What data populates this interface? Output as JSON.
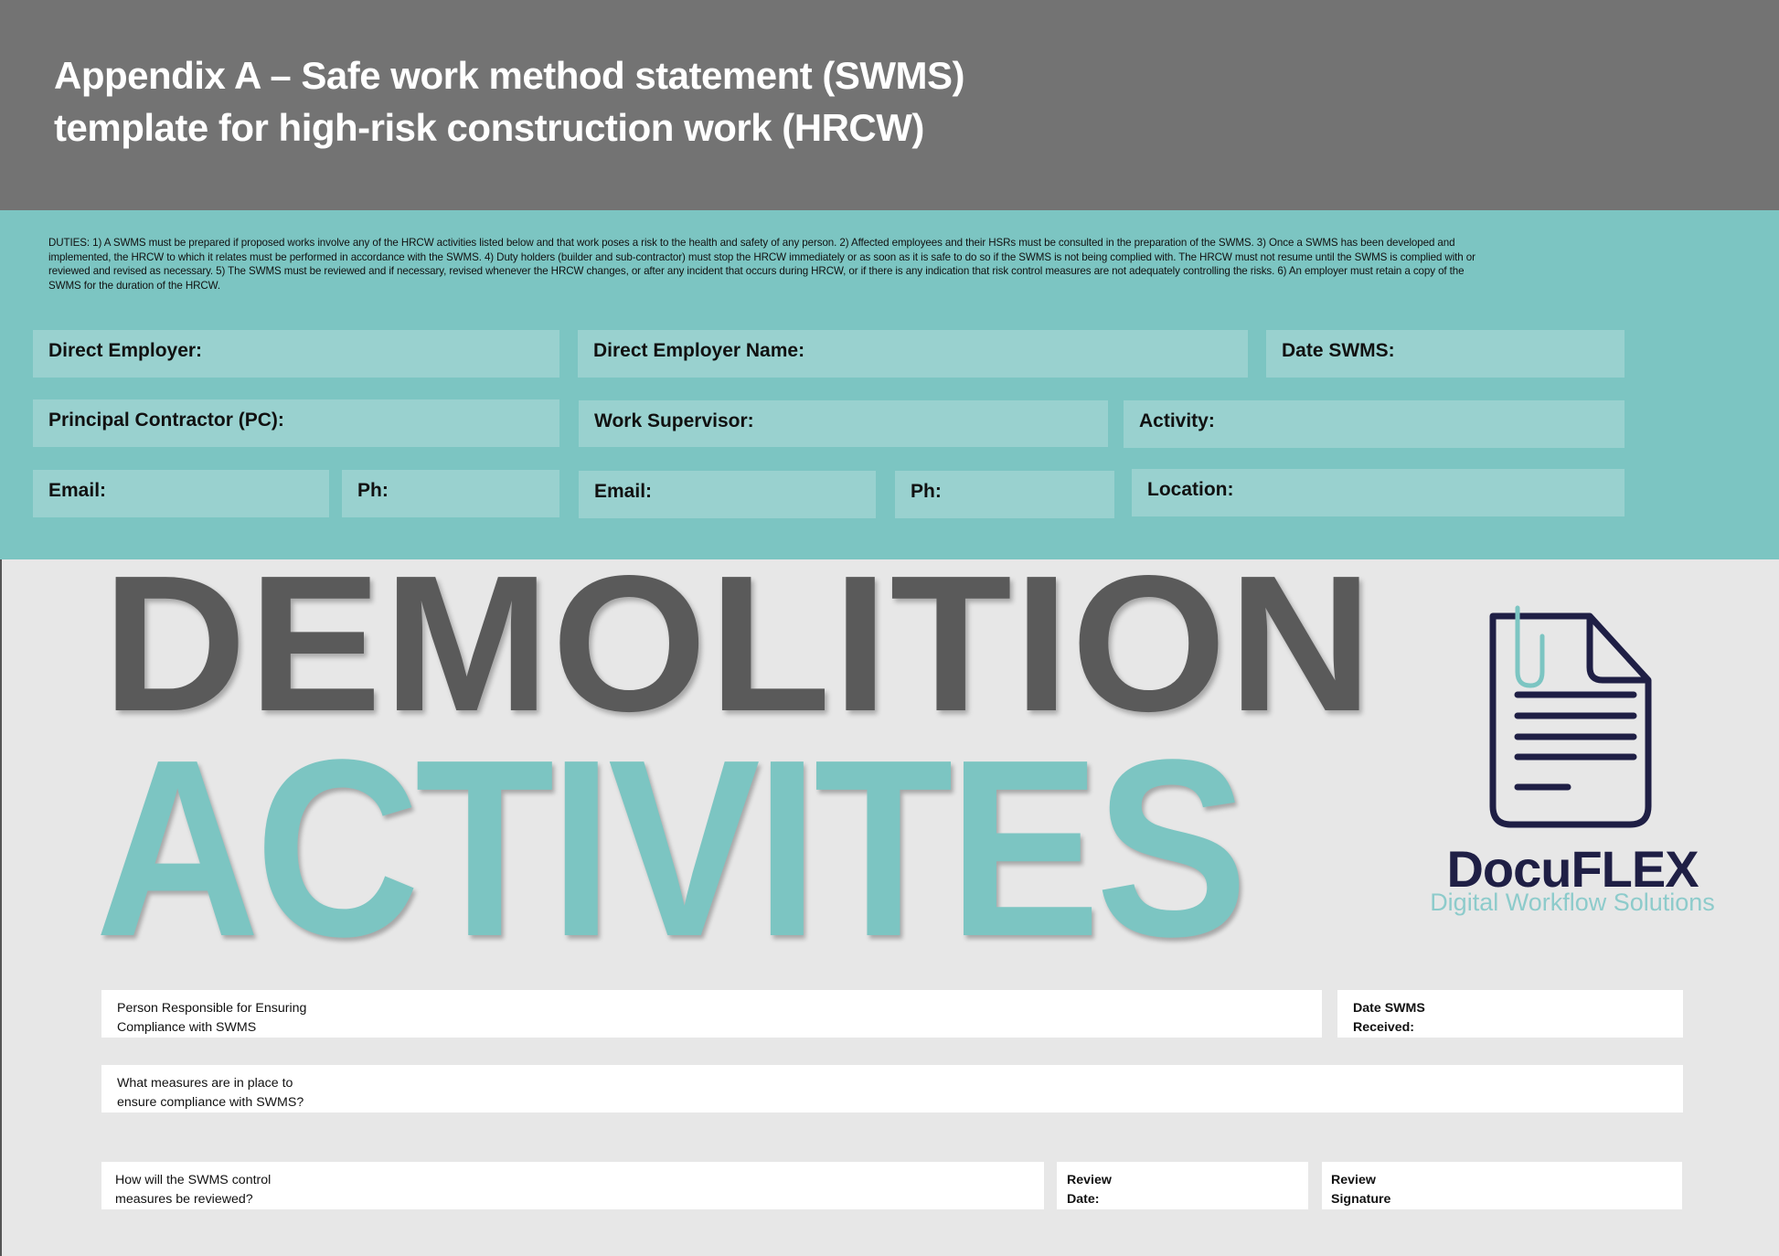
{
  "header": {
    "title_line1": "Appendix A – Safe work method statement (SWMS)",
    "title_line2": "template for high-risk construction work (HRCW)"
  },
  "duties": {
    "text": "DUTIES: 1) A SWMS must be prepared if proposed works involve any of the HRCW activities listed below and that work poses a risk to the health and safety of any person. 2) Affected employees and their HSRs must be consulted in the preparation of the SWMS. 3) Once a SWMS has been developed and implemented, the HRCW to which it relates must be performed in accordance with the SWMS. 4) Duty holders (builder and sub-contractor) must stop the HRCW immediately or as soon as it is safe to do so if the SWMS is not being complied with. The HRCW must not resume until the SWMS is complied with or reviewed and revised as necessary. 5) The SWMS must be reviewed and if necessary, revised whenever the HRCW changes, or after any incident that occurs during HRCW, or if there is any indication that risk control measures are not adequately controlling the risks. 6) An employer must retain a copy of the SWMS for the duration of the HRCW."
  },
  "fields": {
    "direct_employer": "Direct Employer:",
    "direct_employer_name": "Direct Employer Name:",
    "date_swms": "Date SWMS:",
    "principal_contractor": "Principal Contractor (PC):",
    "work_supervisor": "Work Supervisor:",
    "activity": "Activity:",
    "pc_email": "Email:",
    "pc_phone": "Ph:",
    "supervisor_email": "Email:",
    "supervisor_phone": "Ph:",
    "location": "Location:"
  },
  "hero": {
    "line1": "DEMOLITION",
    "line2": "ACTIVITES"
  },
  "logo": {
    "icon": "document-with-paperclip-icon",
    "brand": "DocuFLEX",
    "tagline": "Digital Workflow Solutions"
  },
  "compliance": {
    "person_responsible": "Person Responsible for Ensuring\nCompliance with SWMS",
    "date_received": "Date SWMS\nReceived:",
    "measures": "What measures are in place to\nensure compliance with SWMS?",
    "review_method": "How will the SWMS control\nmeasures be reviewed?",
    "review_date": "Review\nDate:",
    "review_signature": "Review\nSignature"
  },
  "colors": {
    "header_bg": "#737373",
    "teal_band": "#7cc5c2",
    "field_bg": "#99d1cf",
    "page_bg": "#e7e7e7",
    "hero_dark": "#5a5a5a",
    "hero_teal": "#7cc5c2",
    "brand_navy": "#1f1f45"
  }
}
